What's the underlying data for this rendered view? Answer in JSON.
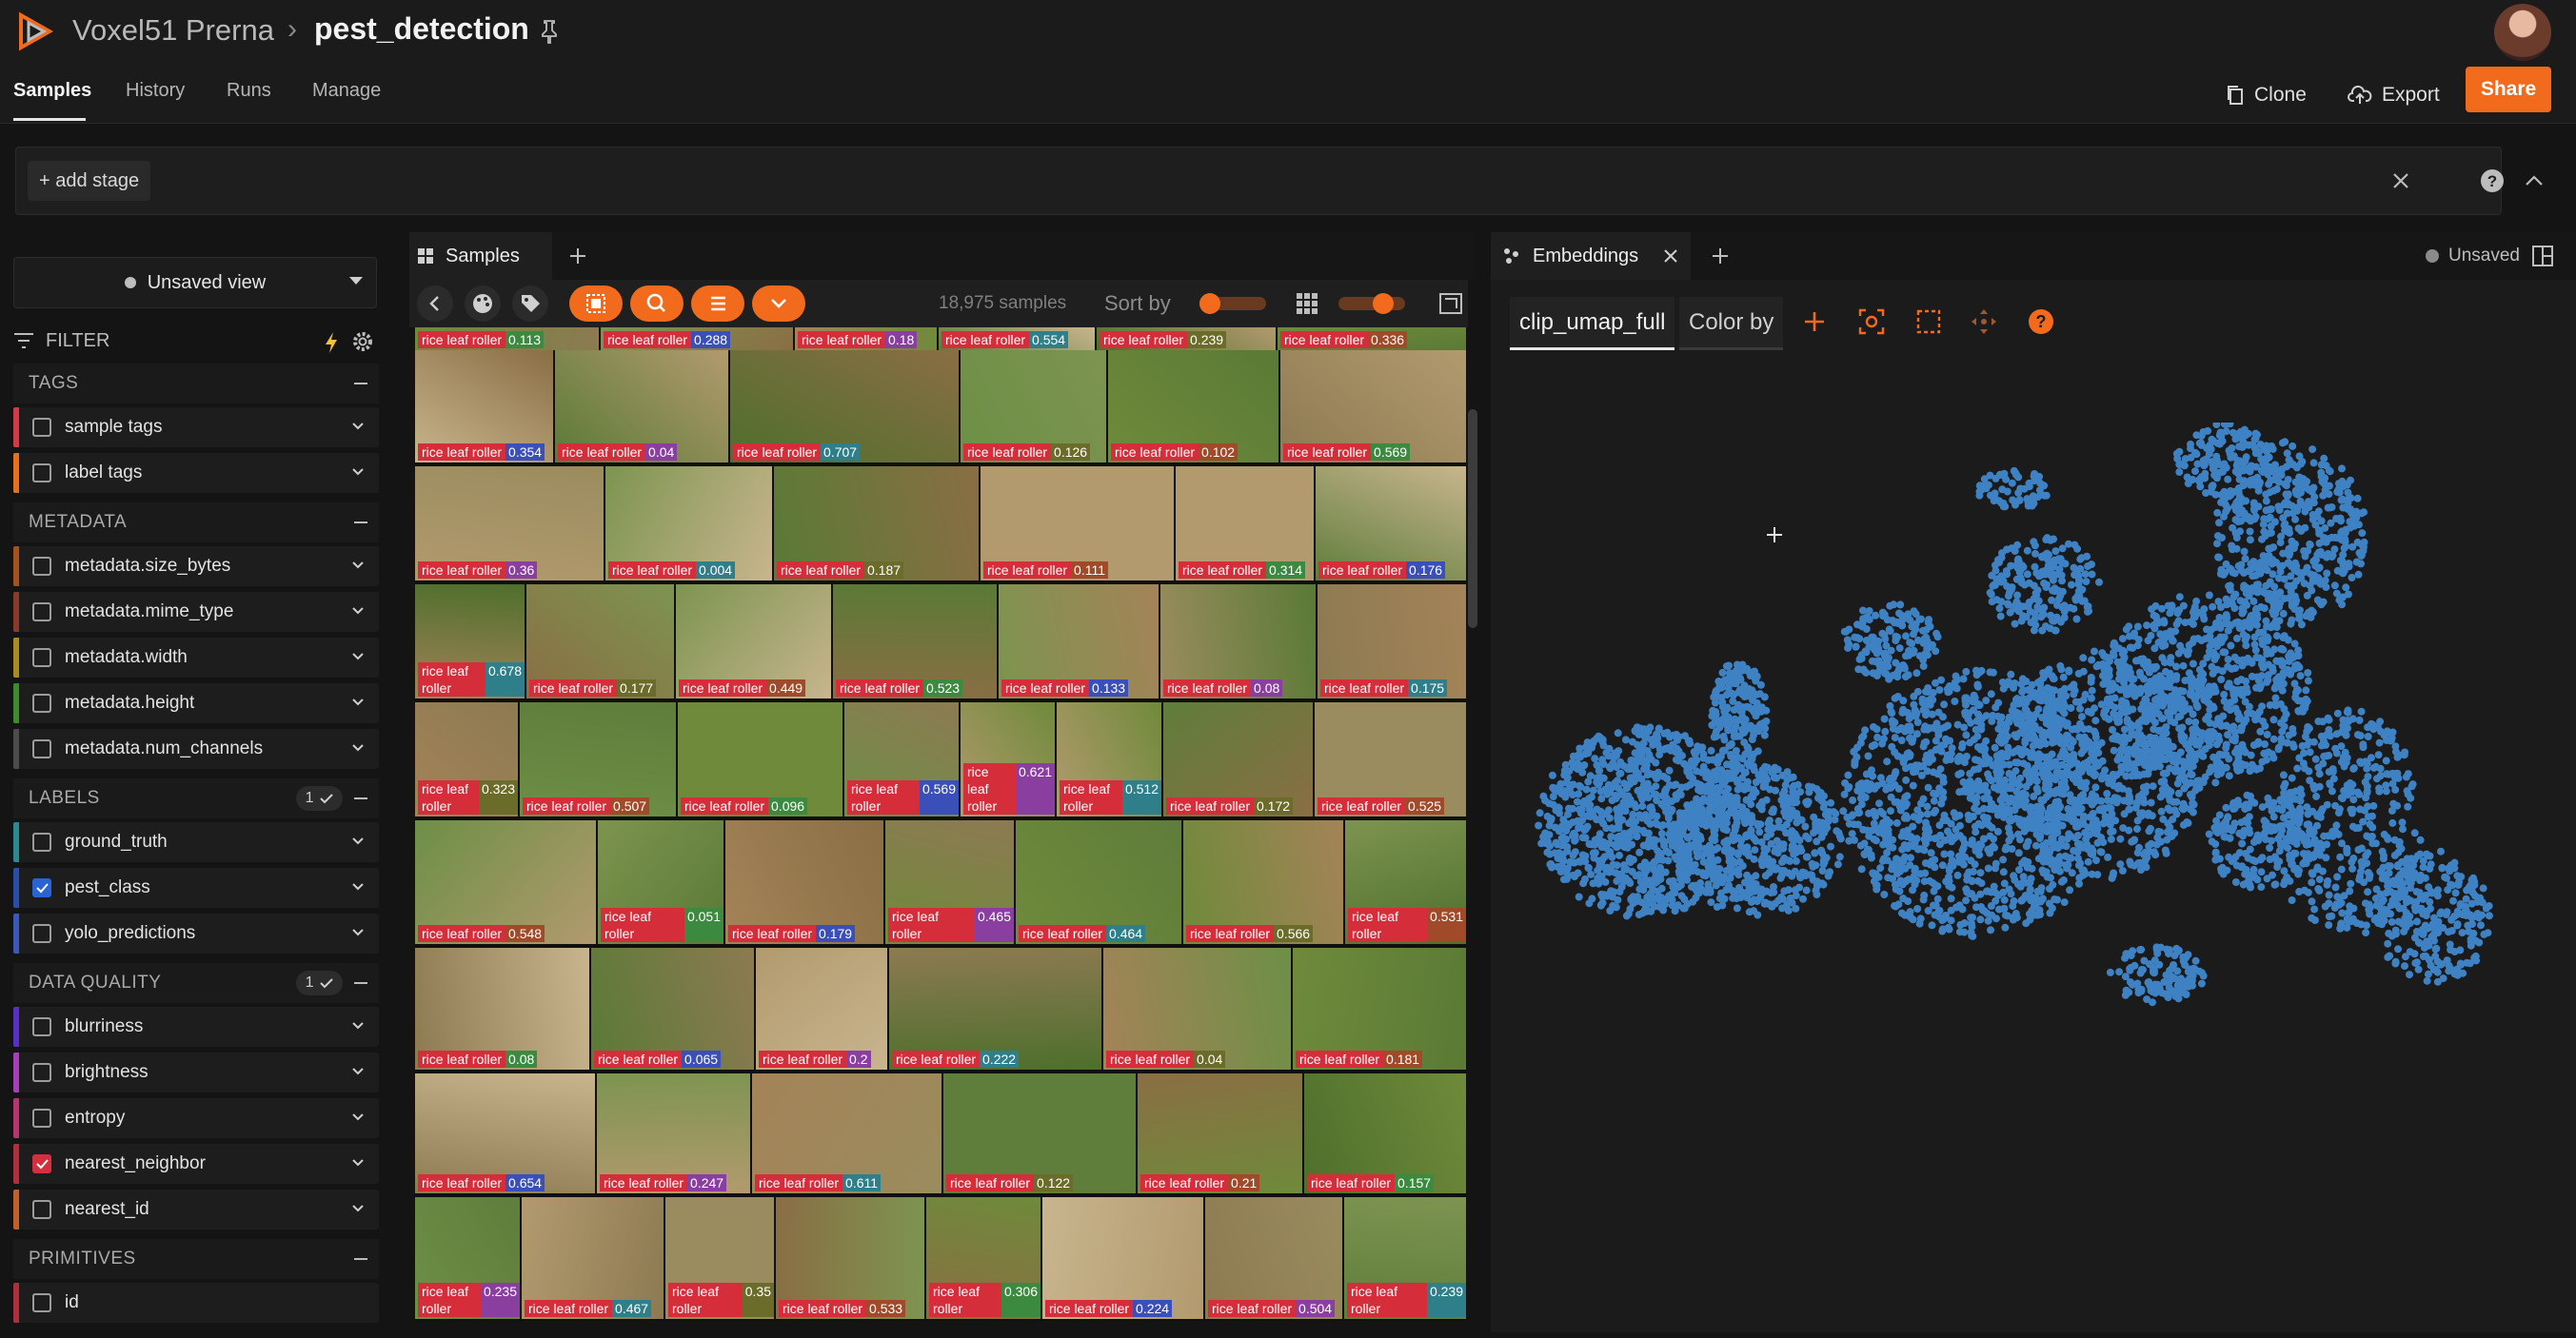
{
  "app": {
    "org_name": "Voxel51 Prerna",
    "crumb_sep": "›",
    "dataset_name": "pest_detection"
  },
  "nav": {
    "tabs": [
      "Samples",
      "History",
      "Runs",
      "Manage"
    ],
    "clone_label": "Clone",
    "export_label": "Export",
    "share_label": "Share"
  },
  "view_bar": {
    "add_stage_label": "+ add stage"
  },
  "sidebar": {
    "view_select": "Unsaved view",
    "filter_label": "FILTER",
    "sections": {
      "tags": "TAGS",
      "metadata": "METADATA",
      "labels": "LABELS",
      "labels_count": "1",
      "data_quality": "DATA QUALITY",
      "data_quality_count": "1",
      "primitives": "PRIMITIVES"
    },
    "fields": {
      "sample_tags": "sample tags",
      "label_tags": "label tags",
      "size_bytes": "metadata.size_bytes",
      "mime_type": "metadata.mime_type",
      "width": "metadata.width",
      "height": "metadata.height",
      "num_channels": "metadata.num_channels",
      "ground_truth": "ground_truth",
      "pest_class": "pest_class",
      "yolo_predictions": "yolo_predictions",
      "blurriness": "blurriness",
      "brightness": "brightness",
      "entropy": "entropy",
      "nearest_neighbor": "nearest_neighbor",
      "nearest_id": "nearest_id",
      "id": "id"
    }
  },
  "samples_panel": {
    "tab_label": "Samples",
    "count_text": "18,975 samples",
    "sort_by_label": "Sort by",
    "label_text": "rice leaf roller",
    "rows": [
      [
        "0.113",
        "0.288",
        "0.18",
        "0.554",
        "0.239",
        "0.336"
      ],
      [
        "0.354",
        "0.04",
        "0.707",
        "0.126",
        "0.102",
        "0.569"
      ],
      [
        "0.36",
        "0.004",
        "0.187",
        "0.111",
        "0.314",
        "0.176"
      ],
      [
        "0.678",
        "0.177",
        "0.449",
        "0.523",
        "0.133",
        "0.08",
        "0.175"
      ],
      [
        "0.323",
        "0.507",
        "0.096",
        "0.569",
        "0.621",
        "0.512",
        "0.172",
        "0.525"
      ],
      [
        "0.548",
        "0.051",
        "0.179",
        "0.465",
        "0.464",
        "0.566",
        "0.531"
      ],
      [
        "0.08",
        "0.065",
        "0.2",
        "0.222",
        "0.04",
        "0.181"
      ],
      [
        "0.654",
        "0.247",
        "0.611",
        "0.122",
        "0.21",
        "0.157"
      ],
      [
        "0.235",
        "0.467",
        "0.35",
        "0.533",
        "0.306",
        "0.224",
        "0.504",
        "0.239"
      ]
    ]
  },
  "embeddings_panel": {
    "tab_label": "Embeddings",
    "unsaved_label": "Unsaved",
    "brain_key": "clip_umap_full",
    "color_by_label": "Color by",
    "point_color": "#3e82c4"
  },
  "colors": {
    "accent": "#f26b1d",
    "label_red": "#d62d3b"
  }
}
